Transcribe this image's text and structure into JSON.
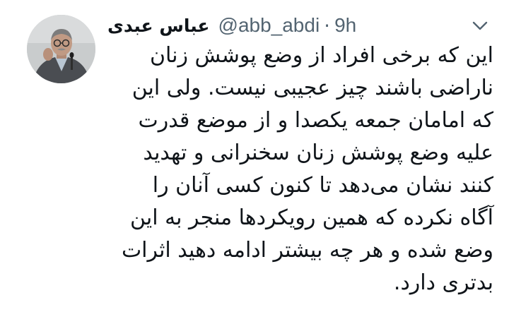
{
  "tweet": {
    "display_name": "عباس عبدی",
    "handle": "@abb_abdi",
    "separator": "·",
    "time": "9h",
    "lines": [
      "این که برخی افراد از وضع پوشش زنان",
      "ناراضی باشند چیز عجیبی نیست. ولی این",
      "که امامان جمعه یکصدا و از موضع قدرت",
      "علیه وضع پوشش زنان سخنرانی و تهدید",
      "کنند نشان می‌دهد تا کنون کسی آنان را",
      "آگاه نکرده که همین رویکردها منجر به این",
      "وضع شده و هر چه بیشتر ادامه دهید اثرات",
      "بدتری دارد."
    ]
  },
  "icons": {
    "avatar": "profile-photo",
    "more": "chevron-down-icon"
  },
  "colors": {
    "text": "#0f1419",
    "secondary": "#536471"
  }
}
